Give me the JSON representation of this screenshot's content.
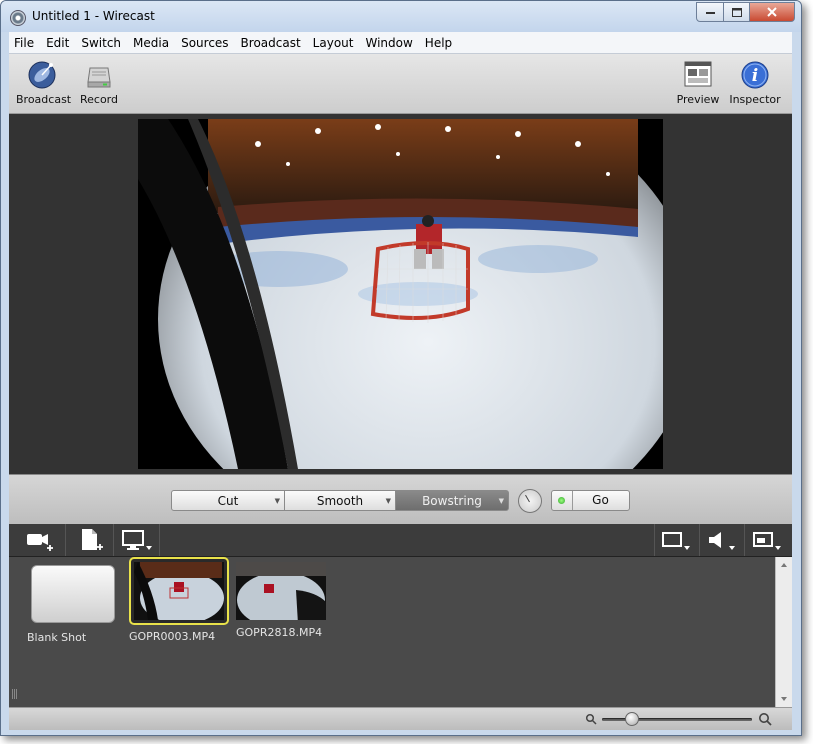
{
  "window": {
    "title": "Untitled 1 - Wirecast",
    "controls": {
      "minimize": "minimize",
      "maximize": "maximize",
      "close": "close"
    }
  },
  "menu": [
    "File",
    "Edit",
    "Switch",
    "Media",
    "Sources",
    "Broadcast",
    "Layout",
    "Window",
    "Help"
  ],
  "toolbar": {
    "broadcast_label": "Broadcast",
    "record_label": "Record",
    "preview_label": "Preview",
    "inspector_label": "Inspector",
    "icons": {
      "broadcast": "satellite-dish-icon",
      "record": "hard-drive-icon",
      "preview": "preview-window-icon",
      "inspector": "info-icon"
    }
  },
  "transitions": {
    "items": [
      "Cut",
      "Smooth",
      "Bowstring"
    ],
    "selected": "Bowstring",
    "speed_icon": "clock-icon"
  },
  "go_button": {
    "label": "Go",
    "led_color": "#3cc63a"
  },
  "shot_toolbar": {
    "left_icons": [
      "add-camera-icon",
      "add-document-icon",
      "display-menu-icon"
    ],
    "right_icons": [
      "layer-rectangle-icon",
      "audio-speaker-icon",
      "layout-menu-icon"
    ]
  },
  "shots": [
    {
      "label": "Blank Shot",
      "kind": "blank",
      "selected": false
    },
    {
      "label": "GOPR0003.MP4",
      "kind": "video",
      "selected": true
    },
    {
      "label": "GOPR2818.MP4",
      "kind": "video",
      "selected": false
    }
  ],
  "colors": {
    "selection_outline": "#e9e24a",
    "stage_background": "#333333",
    "shots_background": "#4a4a4a"
  },
  "zoom": {
    "level": 0.2,
    "icons": [
      "zoom-out-icon",
      "zoom-in-icon"
    ]
  }
}
